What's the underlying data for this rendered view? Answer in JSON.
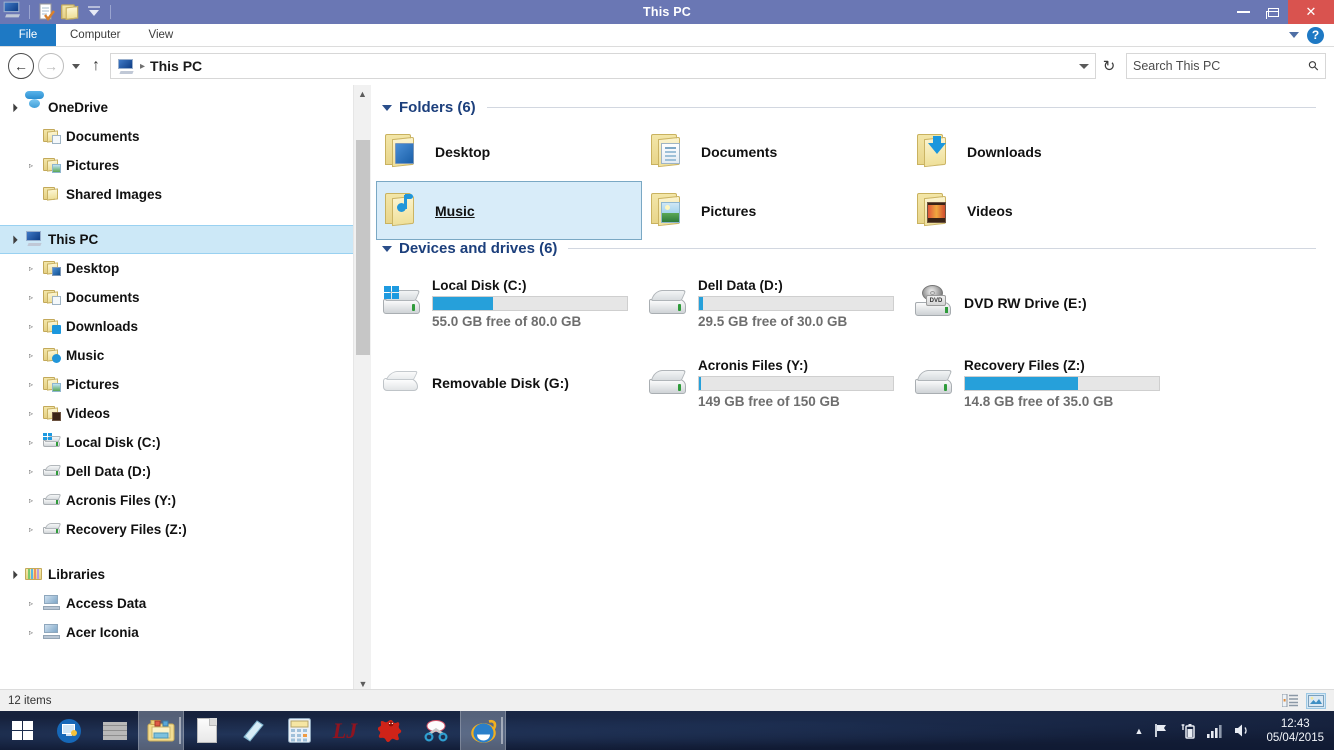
{
  "window": {
    "title": "This PC",
    "quick_access": [
      "this-pc-icon",
      "properties-icon",
      "new-folder-icon",
      "customize-caret-icon"
    ],
    "controls": {
      "minimize": "minimize-button",
      "maximize": "restore-button",
      "close_label": "✕"
    }
  },
  "ribbon": {
    "file_tab": "File",
    "tabs": [
      "Computer",
      "View"
    ],
    "collapse_icon": "chevron-down-icon",
    "help_label": "?"
  },
  "navbar": {
    "back_label": "←",
    "forward_label": "→",
    "recent_caret": "history-caret-icon",
    "up_label": "↑",
    "breadcrumb_icon": "this-pc-icon",
    "breadcrumb_sep": "▸",
    "address_value": "This PC",
    "refresh_label": "↻",
    "search_placeholder": "Search This PC",
    "search_value": "",
    "search_icon": "search-icon"
  },
  "sidebar": {
    "items": [
      {
        "label": "OneDrive",
        "icon": "onedrive-cloud-icon",
        "indent": 0,
        "twisty": "open",
        "selected": false
      },
      {
        "label": "Documents",
        "icon": "folder-documents-icon",
        "indent": 1,
        "twisty": "none",
        "selected": false
      },
      {
        "label": "Pictures",
        "icon": "folder-pictures-icon",
        "indent": 1,
        "twisty": "closed",
        "selected": false
      },
      {
        "label": "Shared Images",
        "icon": "folder-shared-icon",
        "indent": 1,
        "twisty": "none",
        "selected": false
      },
      {
        "label": "This PC",
        "icon": "this-pc-icon",
        "indent": 0,
        "twisty": "open",
        "selected": true
      },
      {
        "label": "Desktop",
        "icon": "folder-desktop-icon",
        "indent": 1,
        "twisty": "closed",
        "selected": false
      },
      {
        "label": "Documents",
        "icon": "folder-documents-icon",
        "indent": 1,
        "twisty": "closed",
        "selected": false
      },
      {
        "label": "Downloads",
        "icon": "folder-downloads-icon",
        "indent": 1,
        "twisty": "closed",
        "selected": false
      },
      {
        "label": "Music",
        "icon": "folder-music-icon",
        "indent": 1,
        "twisty": "closed",
        "selected": false
      },
      {
        "label": "Pictures",
        "icon": "folder-pictures-icon",
        "indent": 1,
        "twisty": "closed",
        "selected": false
      },
      {
        "label": "Videos",
        "icon": "folder-videos-icon",
        "indent": 1,
        "twisty": "closed",
        "selected": false
      },
      {
        "label": "Local Disk (C:)",
        "icon": "hard-drive-windows-icon",
        "indent": 1,
        "twisty": "closed",
        "selected": false
      },
      {
        "label": "Dell Data (D:)",
        "icon": "hard-drive-icon",
        "indent": 1,
        "twisty": "closed",
        "selected": false
      },
      {
        "label": "Acronis Files (Y:)",
        "icon": "hard-drive-icon",
        "indent": 1,
        "twisty": "closed",
        "selected": false
      },
      {
        "label": "Recovery Files (Z:)",
        "icon": "hard-drive-icon",
        "indent": 1,
        "twisty": "closed",
        "selected": false
      },
      {
        "label": "Libraries",
        "icon": "libraries-icon",
        "indent": 0,
        "twisty": "open",
        "selected": false
      },
      {
        "label": "Access Data",
        "icon": "library-icon",
        "indent": 1,
        "twisty": "closed",
        "selected": false
      },
      {
        "label": "Acer Iconia",
        "icon": "library-icon",
        "indent": 1,
        "twisty": "closed",
        "selected": false
      }
    ],
    "scrollbar": {
      "up": "▲",
      "down": "▼"
    }
  },
  "main": {
    "groups": [
      {
        "title": "Folders (6)",
        "twisty": "expanded",
        "items": [
          {
            "name": "Desktop",
            "icon": "folder-desktop-icon",
            "selected": false
          },
          {
            "name": "Documents",
            "icon": "folder-documents-icon",
            "selected": false
          },
          {
            "name": "Downloads",
            "icon": "folder-downloads-icon",
            "selected": false
          },
          {
            "name": "Music",
            "icon": "folder-music-icon",
            "selected": true
          },
          {
            "name": "Pictures",
            "icon": "folder-pictures-icon",
            "selected": false
          },
          {
            "name": "Videos",
            "icon": "folder-videos-icon",
            "selected": false
          }
        ]
      },
      {
        "title": "Devices and drives (6)",
        "twisty": "expanded",
        "drives": [
          {
            "name": "Local Disk (C:)",
            "icon": "hard-drive-windows-icon",
            "free": "55.0 GB free of 80.0 GB",
            "used_pct": 31,
            "has_bar": true,
            "bar_color": "#26a0da"
          },
          {
            "name": "Dell Data (D:)",
            "icon": "hard-drive-icon",
            "free": "29.5 GB free of 30.0 GB",
            "used_pct": 2,
            "has_bar": true,
            "bar_color": "#26a0da"
          },
          {
            "name": "DVD RW Drive (E:)",
            "icon": "dvd-drive-icon",
            "free": "",
            "used_pct": 0,
            "has_bar": false,
            "bar_color": "#26a0da"
          },
          {
            "name": "Removable Disk (G:)",
            "icon": "removable-disk-icon",
            "free": "",
            "used_pct": 0,
            "has_bar": false,
            "bar_color": "#26a0da"
          },
          {
            "name": "Acronis Files (Y:)",
            "icon": "hard-drive-icon",
            "free": "149 GB free of 150 GB",
            "used_pct": 1,
            "has_bar": true,
            "bar_color": "#26a0da"
          },
          {
            "name": "Recovery Files (Z:)",
            "icon": "hard-drive-icon",
            "free": "14.8 GB free of 35.0 GB",
            "used_pct": 58,
            "has_bar": true,
            "bar_color": "#26a0da"
          }
        ]
      }
    ]
  },
  "statusbar": {
    "item_count": "12 items",
    "views": [
      {
        "icon": "details-view-icon",
        "active": false
      },
      {
        "icon": "large-icons-view-icon",
        "active": true
      }
    ]
  },
  "taskbar": {
    "start_icon": "windows-start-icon",
    "items": [
      {
        "icon": "remote-desktop-icon",
        "open": false
      },
      {
        "icon": "brick-wall-icon",
        "open": false
      },
      {
        "icon": "file-explorer-icon",
        "open": true
      },
      {
        "icon": "document-icon",
        "open": false
      },
      {
        "icon": "notepad-icon",
        "open": false
      },
      {
        "icon": "calculator-icon",
        "open": false
      },
      {
        "icon": "lj-logo-icon",
        "open": false
      },
      {
        "icon": "red-splat-icon",
        "open": false
      },
      {
        "icon": "snipping-tool-icon",
        "open": false
      },
      {
        "icon": "internet-explorer-icon",
        "open": true
      }
    ],
    "tray": {
      "show_hidden": "▲",
      "action_center": "flag-icon",
      "battery": "battery-charging-icon",
      "network": "signal-bars-icon",
      "volume": "speaker-icon",
      "time": "12:43",
      "date": "05/04/2015"
    }
  },
  "colors": {
    "titlebar": "#6a77b4",
    "file_tab": "#1e79c4",
    "selection": "#cce8f7",
    "group_heading": "#1c3f7c",
    "progress": "#26a0da",
    "close_button": "#d9534f"
  }
}
